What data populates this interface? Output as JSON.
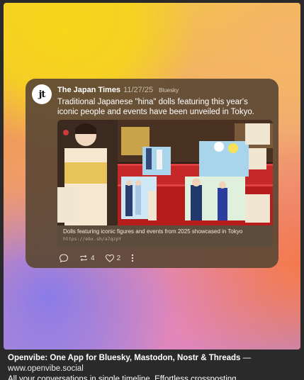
{
  "post": {
    "author": "The Japan Times",
    "avatar_text": "jt",
    "date": "11/27/25",
    "platform": "Bluesky",
    "text": "Traditional Japanese \"hina\" dolls featuring this year's iconic people and events have been unveiled in Tokyo.",
    "embed": {
      "title": "Dolls featuring iconic figures and events from 2025 showcased in Tokyo",
      "url": "https://ebx.sh/a7qzpY"
    },
    "actions": {
      "reply_icon": "reply-icon",
      "repost_icon": "repost-icon",
      "repost_count": "4",
      "like_icon": "heart-icon",
      "like_count": "2",
      "more_icon": "more-icon"
    }
  },
  "footer": {
    "brand": "Openvibe: One App for Bluesky, Mastodon, Nostr & Threads",
    "separator": " — ",
    "url": "www.openvibe.social",
    "tagline": "All your conversations in single timeline. Effortless crossposting."
  },
  "colors": {
    "card": "#5c4834",
    "accent_yellow": "#f6d51a",
    "accent_orange": "#f47a4a",
    "accent_purple": "#8a7ce8"
  }
}
